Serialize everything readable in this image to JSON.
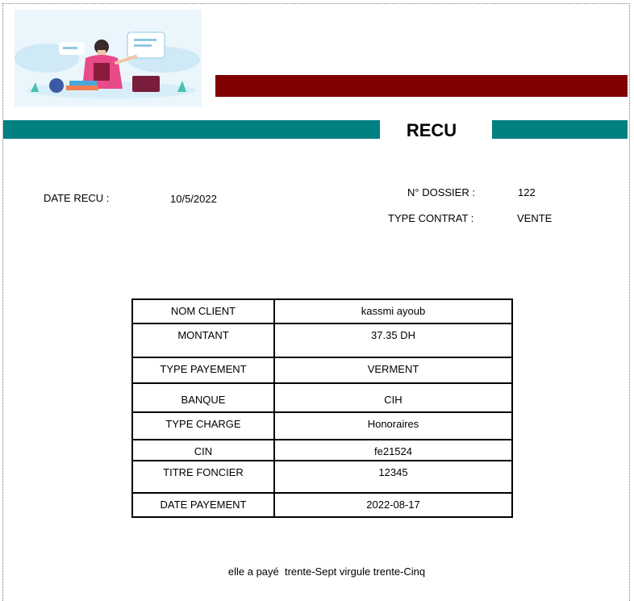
{
  "header": {
    "title": "RECU"
  },
  "meta": {
    "date_label": "DATE RECU :",
    "date_value": "10/5/2022",
    "dossier_label": "N° DOSSIER :",
    "dossier_value": "122",
    "contract_label": "TYPE CONTRAT :",
    "contract_value": "VENTE"
  },
  "table": {
    "rows": [
      {
        "label": "NOM CLIENT",
        "value": "kassmi ayoub"
      },
      {
        "label": "MONTANT",
        "value": "37.35 DH"
      },
      {
        "label": "TYPE PAYEMENT",
        "value": "VERMENT"
      },
      {
        "label": "BANQUE",
        "value": "CIH"
      },
      {
        "label": "TYPE CHARGE",
        "value": "Honoraires"
      },
      {
        "label": "CIN",
        "value": "fe21524"
      },
      {
        "label": "TITRE FONCIER",
        "value": "12345"
      },
      {
        "label": "DATE PAYEMENT",
        "value": "2022-08-17"
      }
    ]
  },
  "footer": {
    "text": "elle a payé  trente-Sept virgule trente-Cinq"
  },
  "colors": {
    "accent_bar": "#800000",
    "teal_band": "#008080"
  },
  "icons": {
    "illustration": "woman-with-books-illustration"
  }
}
